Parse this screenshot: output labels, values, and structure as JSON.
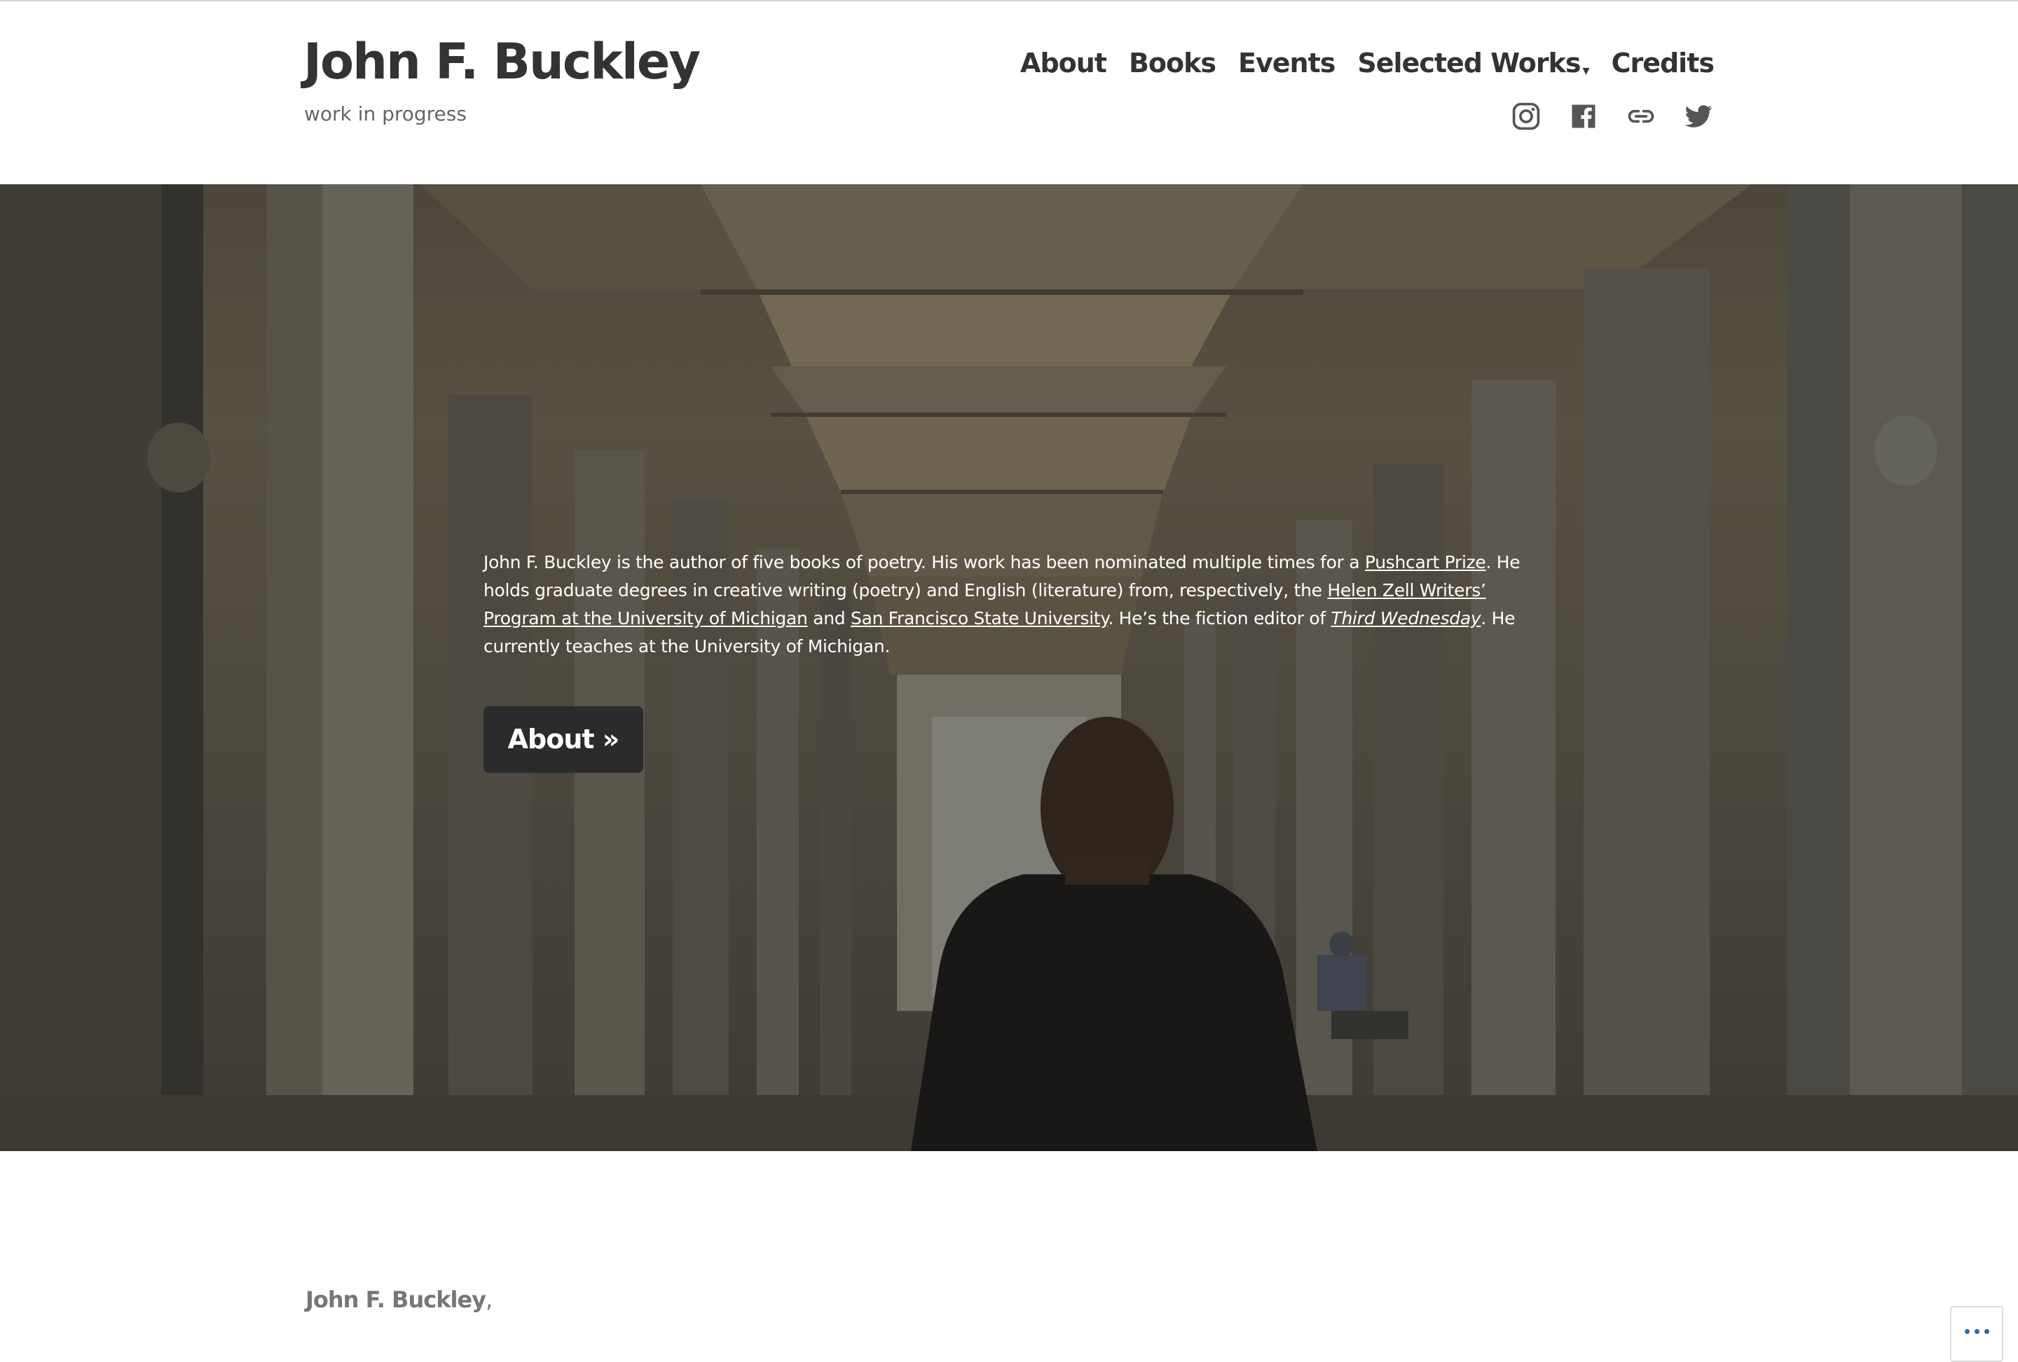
{
  "site": {
    "title": "John F. Buckley",
    "tagline": "work in progress"
  },
  "nav": {
    "items": [
      {
        "label": "About"
      },
      {
        "label": "Books"
      },
      {
        "label": "Events"
      },
      {
        "label": "Selected Works",
        "has_dropdown": true
      },
      {
        "label": "Credits"
      }
    ],
    "dropdown_glyph": "▾"
  },
  "social": [
    {
      "icon": "instagram-icon"
    },
    {
      "icon": "facebook-icon"
    },
    {
      "icon": "link-icon"
    },
    {
      "icon": "twitter-icon"
    }
  ],
  "hero": {
    "text_1": "John F. Buckley is the author of five books of poetry. His work has been nominated multiple times for a ",
    "link_pushcart": "Pushcart Prize",
    "text_2": ". He holds graduate degrees in creative writing (poetry) and English (literature) from, respectively, the ",
    "link_helen_zell": "Helen Zell Writers’ Program at the University of Michigan",
    "text_3": " and ",
    "link_sfsu": "San Francisco State University",
    "text_4": ". He’s the fiction editor of ",
    "link_third_wednesday": "Third Wednesday",
    "text_5": ". He currently teaches at the University of Michigan.",
    "button_label": "About »"
  },
  "content": {
    "author_name": "John F. Buckley",
    "author_suffix": ","
  },
  "colors": {
    "text": "#333333",
    "tagline": "#666666",
    "button_bg": "#2a2b2d",
    "more_dots": "#2d6a9f"
  }
}
